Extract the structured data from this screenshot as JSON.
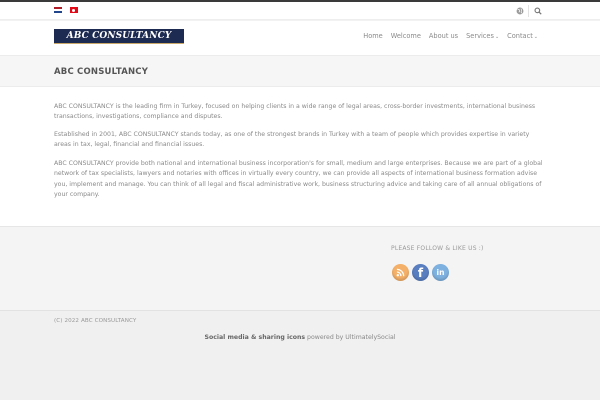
{
  "topbar": {
    "languages": [
      "nl",
      "tr"
    ],
    "icons": [
      "globe-icon",
      "search-icon"
    ]
  },
  "header": {
    "logo_text": "ABC CONSULTANCY",
    "nav": [
      {
        "label": "Home"
      },
      {
        "label": "Welcome"
      },
      {
        "label": "About us"
      },
      {
        "label": "Services",
        "caret": "⌄"
      },
      {
        "label": "Contact",
        "caret": "⌄"
      }
    ]
  },
  "page": {
    "title": "ABC CONSULTANCY",
    "paragraphs": [
      "ABC CONSULTANCY is the leading firm in Turkey, focused on helping clients in a wide range of legal areas, cross-border investments, international business transactions, investigations, compliance and disputes.",
      "Established in 2001, ABC CONSULTANCY stands today, as one of the strongest brands in Turkey with a team of people which provides expertise in variety areas in tax, legal, financial and financial issues.",
      "ABC CONSULTANCY provide both national and international business incorporation's for small, medium and large enterprises. Because we are part of a global network of tax specialists, lawyers and notaries with offices in virtually every country, we can provide all aspects of international business formation advise you, implement and manage. You can think of all legal and fiscal administrative work, business structuring advice and taking care of all annual obligations of your company."
    ]
  },
  "widgets": {
    "follow_label": "PLEASE FOLLOW & LIKE US :)",
    "social": [
      {
        "icon": "rss-icon",
        "glyph": "",
        "color": "#f4b068"
      },
      {
        "icon": "facebook-icon",
        "glyph": "f",
        "color": "#5a7fc0"
      },
      {
        "icon": "linkedin-icon",
        "glyph": "in",
        "color": "#7eb1df"
      }
    ]
  },
  "footer": {
    "copyright": "(C) 2022 ABC CONSULTANCY",
    "credit_link": "Social media & sharing icons",
    "credit_rest": " powered by UltimatelySocial"
  }
}
